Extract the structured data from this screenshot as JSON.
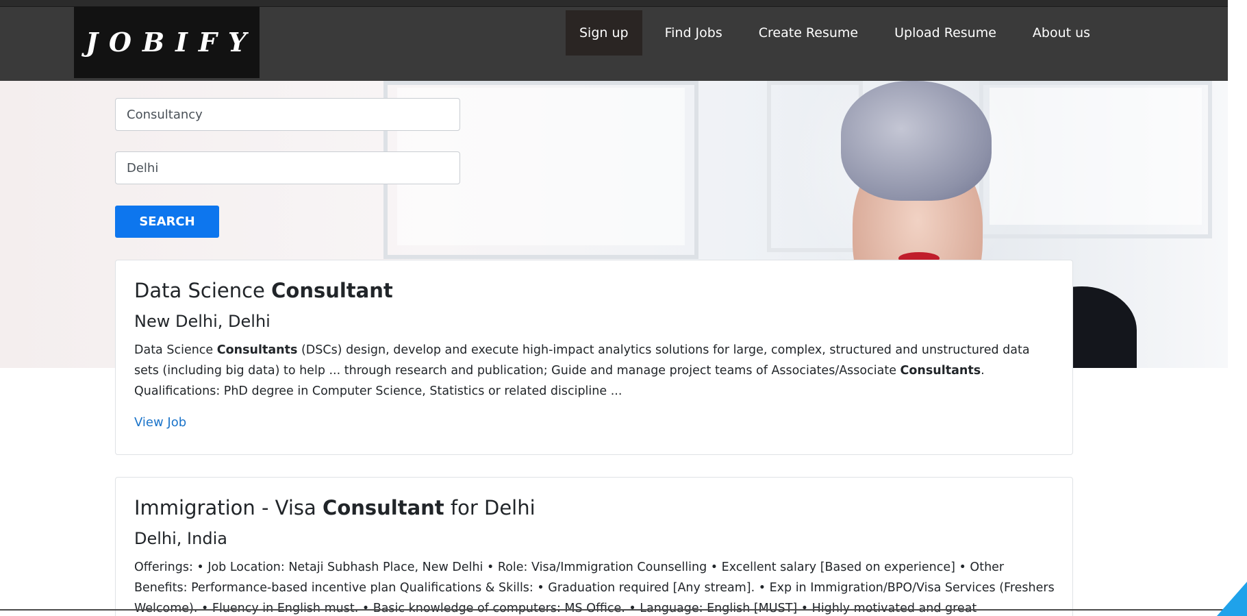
{
  "brand": {
    "logo_text": "JOBIFY"
  },
  "nav": {
    "items": [
      {
        "label": "Sign up"
      },
      {
        "label": "Find Jobs"
      },
      {
        "label": "Create Resume"
      },
      {
        "label": "Upload Resume"
      },
      {
        "label": "About us"
      }
    ]
  },
  "search": {
    "keyword_value": "Consultancy",
    "location_value": "Delhi",
    "button_label": "SEARCH"
  },
  "jobs": [
    {
      "title_pre": "Data Science ",
      "title_bold": "Consultant",
      "title_post": "",
      "location": "New Delhi, Delhi",
      "desc_1": "Data Science ",
      "desc_bold_1": "Consultants",
      "desc_2": " (DSCs) design, develop and execute high-impact analytics solutions for large, complex, structured and unstructured data sets (including big data) to help ... through research and publication; Guide and manage project teams of Associates/Associate ",
      "desc_bold_2": "Consultants",
      "desc_3": ". Qualifications: PhD degree in Computer Science, Statistics or related discipline ...",
      "link_label": "View Job"
    },
    {
      "title_pre": "Immigration - Visa ",
      "title_bold": "Consultant",
      "title_post": " for Delhi",
      "location": "Delhi, India",
      "desc": "Offerings: • Job Location: Netaji Subhash Place, New Delhi • Role: Visa/Immigration Counselling • Excellent salary [Based on experience] • Other Benefits: Performance-based incentive plan Qualifications & Skills: • Graduation required [Any stream]. • Exp in Immigration/BPO/Visa Services (Freshers Welcome). • Fluency in English must. • Basic knowledge of computers: MS Office. • Language: English [MUST] • Highly motivated and great interpersonal skills. • Must"
    }
  ],
  "colors": {
    "navbar": "#3a3a3a",
    "logo_bg": "#121212",
    "active_nav": "#2a2523",
    "search_button": "#0d76ee",
    "link": "#1a73c9"
  }
}
